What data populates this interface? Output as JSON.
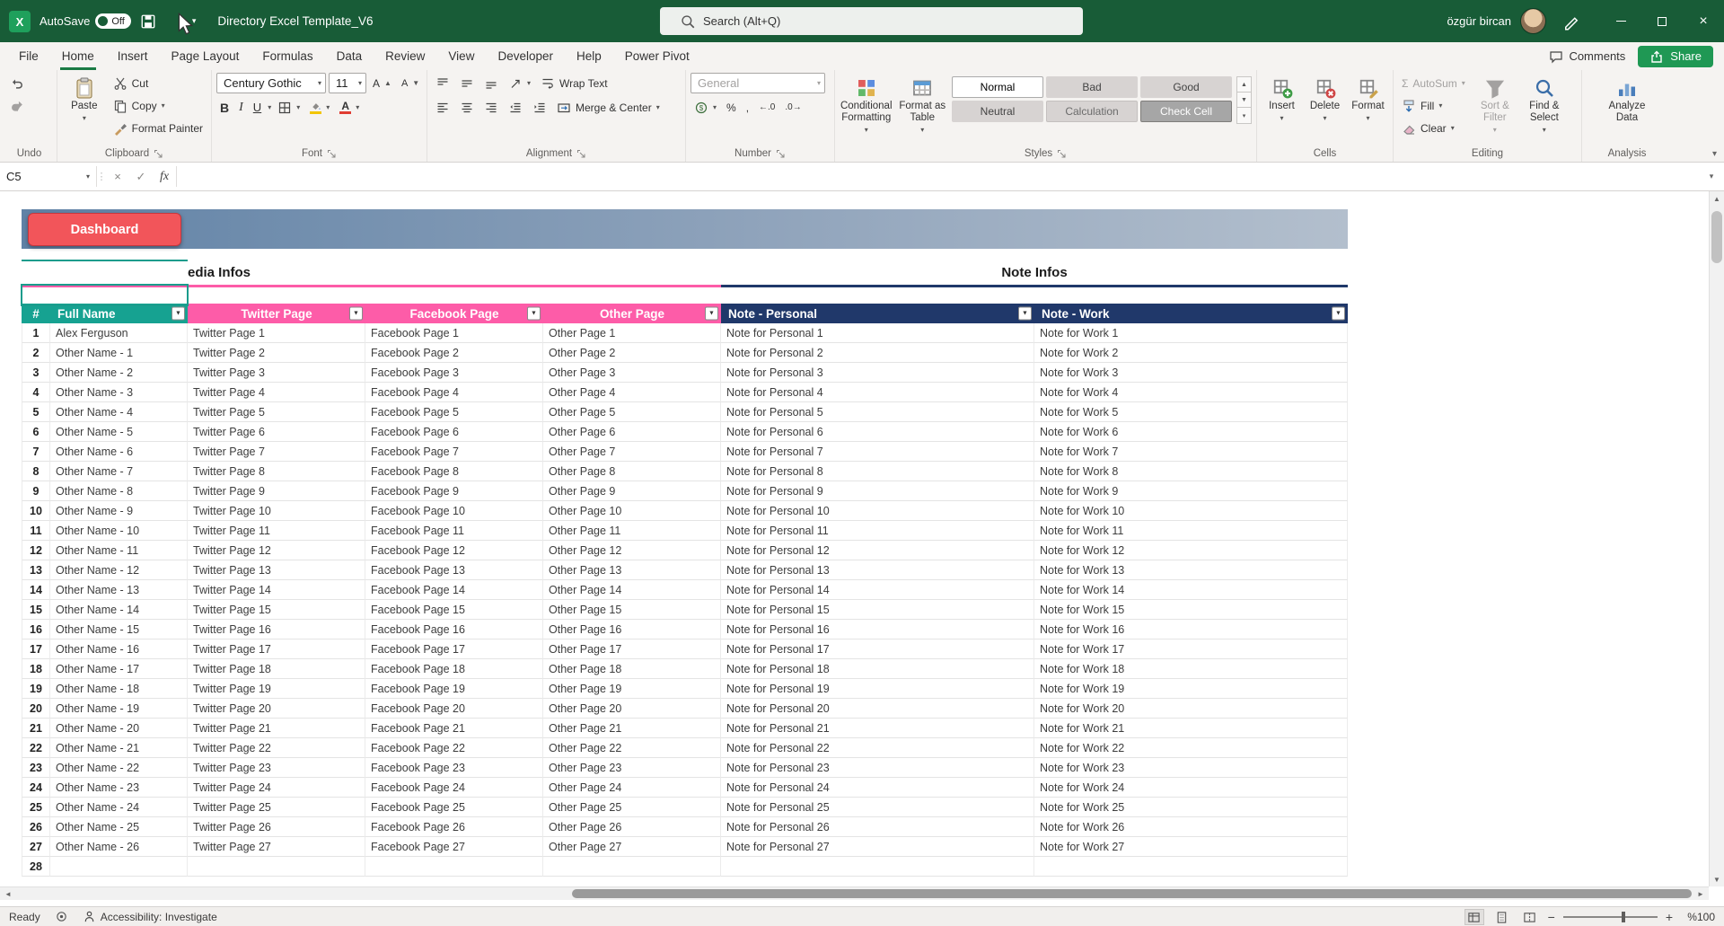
{
  "colors": {
    "titlebar_green": "#185c37",
    "share_green": "#1f9854",
    "tab_underline": "#1a7a44",
    "header_teal": "#16a291",
    "header_pink": "#fd5ca8",
    "header_navy": "#20386a",
    "dashboard_red": "#f2555a",
    "selection_teal": "#1a9c8c"
  },
  "icons": {
    "chevron_down": "▾",
    "filter": "▼",
    "triangle_up": "▲",
    "triangle_down": "▼",
    "triangle_left": "◄",
    "triangle_right": "►",
    "close": "×",
    "check": "✓",
    "cancel": "×",
    "sigma": "Σ",
    "percent": "%",
    "comma": ",",
    "dollar": "$",
    "bold": "B",
    "italic": "I",
    "underline": "U",
    "letter_a": "A",
    "inc_decimal": "←.0",
    "dec_decimal": ".0→",
    "minus": "−",
    "plus": "+",
    "collapse": "▾",
    "dots": "⋮"
  },
  "titlebar": {
    "autosave_label": "AutoSave",
    "autosave_state": "Off",
    "title": "Directory Excel Template_V6",
    "search_placeholder": "Search (Alt+Q)",
    "user_name": "özgür bircan"
  },
  "tabrow": {
    "tabs": [
      {
        "label": "File",
        "active": false
      },
      {
        "label": "Home",
        "active": true
      },
      {
        "label": "Insert",
        "active": false
      },
      {
        "label": "Page Layout",
        "active": false
      },
      {
        "label": "Formulas",
        "active": false
      },
      {
        "label": "Data",
        "active": false
      },
      {
        "label": "Review",
        "active": false
      },
      {
        "label": "View",
        "active": false
      },
      {
        "label": "Developer",
        "active": false
      },
      {
        "label": "Help",
        "active": false
      },
      {
        "label": "Power Pivot",
        "active": false
      }
    ],
    "comments": "Comments",
    "share": "Share"
  },
  "ribbon": {
    "undo": {
      "label": "Undo"
    },
    "clipboard": {
      "label": "Clipboard",
      "paste": "Paste",
      "cut": "Cut",
      "copy": "Copy",
      "format_painter": "Format Painter"
    },
    "font": {
      "label": "Font",
      "name": "Century Gothic",
      "size": "11"
    },
    "alignment": {
      "label": "Alignment",
      "wrap": "Wrap Text",
      "merge": "Merge & Center"
    },
    "number": {
      "label": "Number",
      "format": "General"
    },
    "styles": {
      "label": "Styles",
      "conditional": "Conditional Formatting",
      "format_table": "Format as Table",
      "gallery": [
        "Normal",
        "Bad",
        "Good",
        "Neutral",
        "Calculation",
        "Check Cell"
      ]
    },
    "cells": {
      "label": "Cells",
      "items": [
        "Insert",
        "Delete",
        "Format"
      ]
    },
    "editing": {
      "label": "Editing",
      "autosum": "AutoSum",
      "fill": "Fill",
      "clear": "Clear",
      "sort": "Sort & Filter",
      "find": "Find & Select"
    },
    "analysis": {
      "label": "Analysis",
      "analyze": "Analyze Data"
    }
  },
  "formula_bar": {
    "name_box": "C5",
    "fx": "fx",
    "value": ""
  },
  "sheet": {
    "dashboard_button": "Dashboard",
    "section_media": "edia Infos",
    "section_notes": "Note Infos",
    "columns": [
      {
        "label": "#",
        "color": "teal",
        "align": "center",
        "filter": false
      },
      {
        "label": "Full Name",
        "color": "teal",
        "align": "left",
        "filter": true
      },
      {
        "label": "Twitter Page",
        "color": "pink",
        "align": "center",
        "filter": true
      },
      {
        "label": "Facebook Page",
        "color": "pink",
        "align": "center",
        "filter": true
      },
      {
        "label": "Other Page",
        "color": "pink",
        "align": "center",
        "filter": true
      },
      {
        "label": "Note - Personal",
        "color": "navy",
        "align": "left",
        "filter": true
      },
      {
        "label": "Note - Work",
        "color": "navy",
        "align": "left",
        "filter": true
      }
    ],
    "rows": [
      [
        "1",
        "Alex Ferguson",
        "Twitter Page 1",
        "Facebook Page 1",
        "Other Page 1",
        "Note for Personal 1",
        "Note for Work 1"
      ],
      [
        "2",
        "Other Name - 1",
        "Twitter Page 2",
        "Facebook Page 2",
        "Other Page 2",
        "Note for Personal 2",
        "Note for Work 2"
      ],
      [
        "3",
        "Other Name - 2",
        "Twitter Page 3",
        "Facebook Page 3",
        "Other Page 3",
        "Note for Personal 3",
        "Note for Work 3"
      ],
      [
        "4",
        "Other Name - 3",
        "Twitter Page 4",
        "Facebook Page 4",
        "Other Page 4",
        "Note for Personal 4",
        "Note for Work 4"
      ],
      [
        "5",
        "Other Name - 4",
        "Twitter Page 5",
        "Facebook Page 5",
        "Other Page 5",
        "Note for Personal 5",
        "Note for Work 5"
      ],
      [
        "6",
        "Other Name - 5",
        "Twitter Page 6",
        "Facebook Page 6",
        "Other Page 6",
        "Note for Personal 6",
        "Note for Work 6"
      ],
      [
        "7",
        "Other Name - 6",
        "Twitter Page 7",
        "Facebook Page 7",
        "Other Page 7",
        "Note for Personal 7",
        "Note for Work 7"
      ],
      [
        "8",
        "Other Name - 7",
        "Twitter Page 8",
        "Facebook Page 8",
        "Other Page 8",
        "Note for Personal 8",
        "Note for Work 8"
      ],
      [
        "9",
        "Other Name - 8",
        "Twitter Page 9",
        "Facebook Page 9",
        "Other Page 9",
        "Note for Personal 9",
        "Note for Work 9"
      ],
      [
        "10",
        "Other Name - 9",
        "Twitter Page 10",
        "Facebook Page 10",
        "Other Page 10",
        "Note for Personal 10",
        "Note for Work 10"
      ],
      [
        "11",
        "Other Name - 10",
        "Twitter Page 11",
        "Facebook Page 11",
        "Other Page 11",
        "Note for Personal 11",
        "Note for Work 11"
      ],
      [
        "12",
        "Other Name - 11",
        "Twitter Page 12",
        "Facebook Page 12",
        "Other Page 12",
        "Note for Personal 12",
        "Note for Work 12"
      ],
      [
        "13",
        "Other Name - 12",
        "Twitter Page 13",
        "Facebook Page 13",
        "Other Page 13",
        "Note for Personal 13",
        "Note for Work 13"
      ],
      [
        "14",
        "Other Name - 13",
        "Twitter Page 14",
        "Facebook Page 14",
        "Other Page 14",
        "Note for Personal 14",
        "Note for Work 14"
      ],
      [
        "15",
        "Other Name - 14",
        "Twitter Page 15",
        "Facebook Page 15",
        "Other Page 15",
        "Note for Personal 15",
        "Note for Work 15"
      ],
      [
        "16",
        "Other Name - 15",
        "Twitter Page 16",
        "Facebook Page 16",
        "Other Page 16",
        "Note for Personal 16",
        "Note for Work 16"
      ],
      [
        "17",
        "Other Name - 16",
        "Twitter Page 17",
        "Facebook Page 17",
        "Other Page 17",
        "Note for Personal 17",
        "Note for Work 17"
      ],
      [
        "18",
        "Other Name - 17",
        "Twitter Page 18",
        "Facebook Page 18",
        "Other Page 18",
        "Note for Personal 18",
        "Note for Work 18"
      ],
      [
        "19",
        "Other Name - 18",
        "Twitter Page 19",
        "Facebook Page 19",
        "Other Page 19",
        "Note for Personal 19",
        "Note for Work 19"
      ],
      [
        "20",
        "Other Name - 19",
        "Twitter Page 20",
        "Facebook Page 20",
        "Other Page 20",
        "Note for Personal 20",
        "Note for Work 20"
      ],
      [
        "21",
        "Other Name - 20",
        "Twitter Page 21",
        "Facebook Page 21",
        "Other Page 21",
        "Note for Personal 21",
        "Note for Work 21"
      ],
      [
        "22",
        "Other Name - 21",
        "Twitter Page 22",
        "Facebook Page 22",
        "Other Page 22",
        "Note for Personal 22",
        "Note for Work 22"
      ],
      [
        "23",
        "Other Name - 22",
        "Twitter Page 23",
        "Facebook Page 23",
        "Other Page 23",
        "Note for Personal 23",
        "Note for Work 23"
      ],
      [
        "24",
        "Other Name - 23",
        "Twitter Page 24",
        "Facebook Page 24",
        "Other Page 24",
        "Note for Personal 24",
        "Note for Work 24"
      ],
      [
        "25",
        "Other Name - 24",
        "Twitter Page 25",
        "Facebook Page 25",
        "Other Page 25",
        "Note for Personal 25",
        "Note for Work 25"
      ],
      [
        "26",
        "Other Name - 25",
        "Twitter Page 26",
        "Facebook Page 26",
        "Other Page 26",
        "Note for Personal 26",
        "Note for Work 26"
      ],
      [
        "27",
        "Other Name - 26",
        "Twitter Page 27",
        "Facebook Page 27",
        "Other Page 27",
        "Note for Personal 27",
        "Note for Work 27"
      ],
      [
        "28",
        "",
        "",
        "",
        "",
        "",
        ""
      ]
    ]
  },
  "status_bar": {
    "ready": "Ready",
    "accessibility": "Accessibility: Investigate",
    "zoom": "%100"
  }
}
